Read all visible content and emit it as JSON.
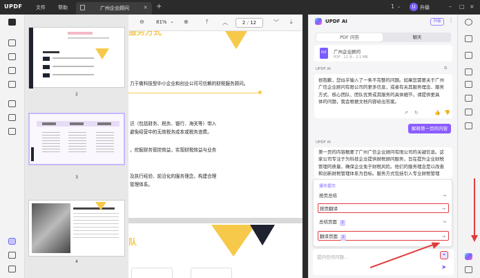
{
  "titlebar": {
    "logo": "UPDF",
    "menu": [
      "文件",
      "帮助"
    ],
    "doc_tab": "广州企业顾问",
    "tab_close": "×",
    "add_tab": "+",
    "notif_count": "1",
    "user_initial": "U",
    "upgrade": "升级"
  },
  "doc_toolbar": {
    "zoom": "81%",
    "zoom_caret": "⌄",
    "page_current": "2",
    "page_total": "12"
  },
  "thumbnails": [
    {
      "num": "2",
      "selected": false
    },
    {
      "num": "3",
      "selected": true
    },
    {
      "num": "4",
      "selected": false
    }
  ],
  "document": {
    "heading_top": "服务方式",
    "lines_p1": [
      "力于做科技型中小企业和创业公司可信赖的财税服务顾问。",
      "识（包括财务、税务、银行、海关等）带入",
      "避免经营中的无效税务成本或税务浪费。",
      "，挖掘财务管控效益，实现财税效益与业务",
      "及执行经验、前沿化的服务理念，构建合理",
      "管理体系。"
    ],
    "heading_bottom": "队"
  },
  "ai": {
    "title": "UPDF AI",
    "upgrade": "升级",
    "tabs": [
      "PDF 问答",
      "聊天"
    ],
    "file_name": "广州企业顾问",
    "file_meta": "PDF · 12 页 · 2.1 MB",
    "bot_name": "UPDF AI",
    "msg1": [
      "很抱歉，您似乎输入了一条不完整的问题。如果您需要关于广州",
      "广信企业顾问有限公司的更多信息，或者有关其服务理念、服务",
      "方式、核心团队、团队优势或其服务的具体细节，请提供更具",
      "体的问题，我会根据文档内容给出答案。"
    ],
    "chip": "解释第一页的内容",
    "bot_name2": "UPDF AI",
    "msg2": [
      "第一页的内容概要了广州广信企业顾问有限公司的关键信息。这",
      "家公司专注于为科技企业提供财税顾问服务，旨在提升企业财税",
      "管理的质量，确保企业免于财税风险。他们的服务理念是以改善",
      "和创新财税管理体系为目标。服务方式包括引入专业财税管理"
    ],
    "prompt_menu": {
      "header": "操作提示",
      "items": [
        {
          "label": "按页总结",
          "badge": "",
          "highlight": false
        },
        {
          "label": "按页翻译",
          "badge": "",
          "highlight": true
        },
        {
          "label": "总结页面",
          "badge": "2",
          "highlight": false
        },
        {
          "label": "翻译页面",
          "badge": "2",
          "highlight": true
        }
      ]
    },
    "input_placeholder": "提问任何问题..."
  },
  "colors": {
    "accent": "#7a5cff",
    "highlight_red": "#e23b3b",
    "doc_yellow": "#f6c94a",
    "doc_dark": "#1f2330"
  }
}
